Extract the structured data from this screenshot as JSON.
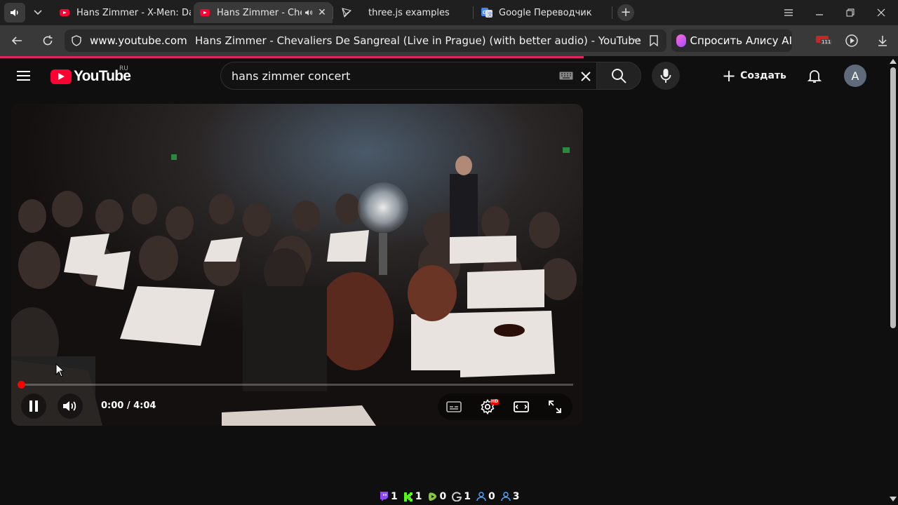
{
  "browser": {
    "tabs": [
      {
        "title": "Hans Zimmer - X-Men: Dar",
        "icon": "youtube-icon",
        "active": false
      },
      {
        "title": "Hans Zimmer - Cheva",
        "icon": "youtube-icon",
        "active": true,
        "audio": true
      },
      {
        "title": "three.js examples",
        "icon": "threejs-icon",
        "active": false
      },
      {
        "title": "Google Переводчик",
        "icon": "google-translate-icon",
        "active": false
      }
    ],
    "new_tab_label": "+",
    "address": {
      "domain": "www.youtube.com",
      "page_title": "Hans Zimmer - Chevaliers De Sangreal (Live in Prague) (with better audio) - YouTube",
      "more": "···"
    },
    "alice_label": "Спросить Алису AI",
    "ext_badge": "111",
    "accent": "#e0245e"
  },
  "youtube": {
    "logo_text": "YouTube",
    "country_code": "RU",
    "search": {
      "query": "hans zimmer concert"
    },
    "create_label": "Создать",
    "avatar_letter": "A",
    "brand_color": "#ff0033"
  },
  "player": {
    "current_time": "0:00",
    "duration": "4:04",
    "time_display": "0:00 / 4:04",
    "progress_fraction": 0.0,
    "hd_badge": "HD",
    "state": "playing"
  },
  "status_counters": [
    {
      "icon": "twitch-icon",
      "value": "1",
      "color": "#9146ff"
    },
    {
      "icon": "kick-icon",
      "value": "1",
      "color": "#53fc18"
    },
    {
      "icon": "rumble-icon",
      "value": "0",
      "color": "#85c742"
    },
    {
      "icon": "g-icon",
      "value": "1",
      "color": "#cccccc"
    },
    {
      "icon": "user-icon",
      "value": "0",
      "color": "#4aa3ff"
    },
    {
      "icon": "users-icon",
      "value": "3",
      "color": "#4aa3ff"
    }
  ]
}
